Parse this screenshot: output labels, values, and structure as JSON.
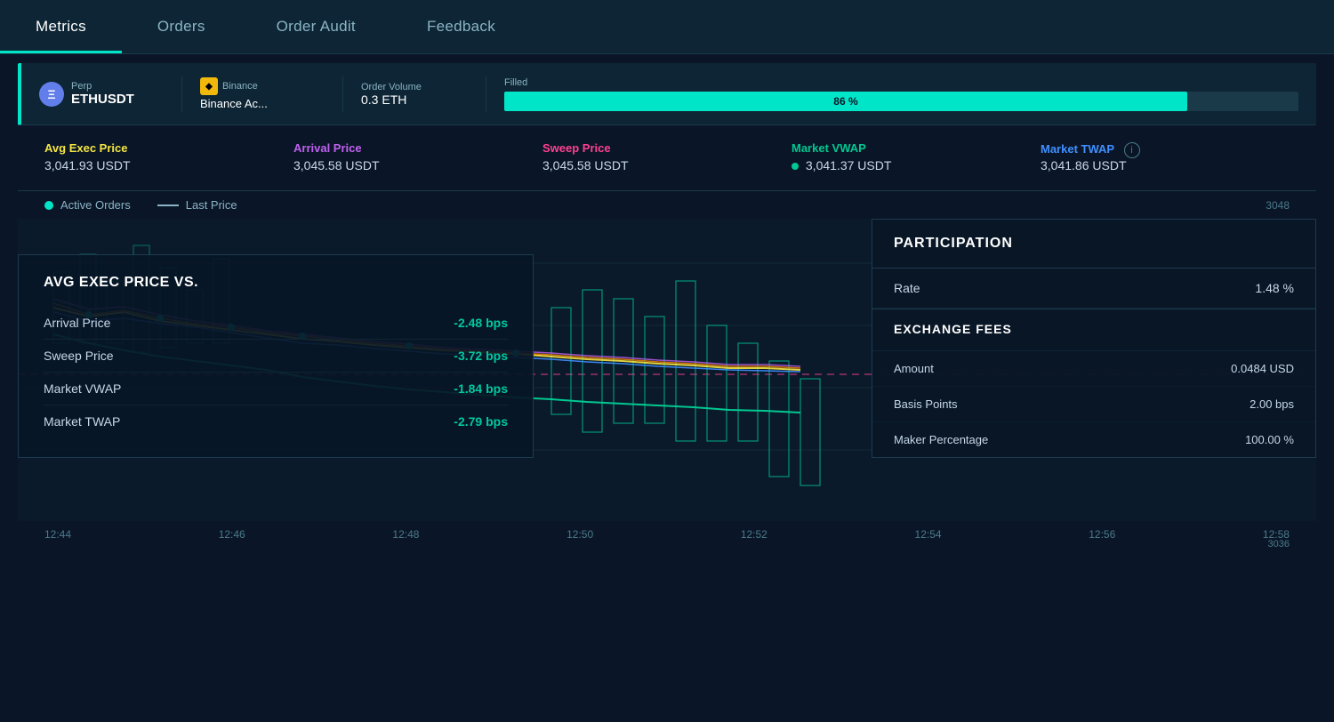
{
  "nav": {
    "tabs": [
      {
        "id": "metrics",
        "label": "Metrics",
        "active": true
      },
      {
        "id": "orders",
        "label": "Orders",
        "active": false
      },
      {
        "id": "order-audit",
        "label": "Order Audit",
        "active": false
      },
      {
        "id": "feedback",
        "label": "Feedback",
        "active": false
      }
    ]
  },
  "order": {
    "type_label": "Perp",
    "symbol": "ETHUSDT",
    "exchange_label": "Binance",
    "exchange_account": "Binance Ac...",
    "volume_label": "Order Volume",
    "volume_value": "0.3 ETH",
    "filled_label": "Filled",
    "fill_percent": 86,
    "fill_percent_text": "86 %"
  },
  "metrics": {
    "avg_exec": {
      "label": "Avg Exec Price",
      "value": "3,041.93 USDT"
    },
    "arrival": {
      "label": "Arrival Price",
      "value": "3,045.58 USDT"
    },
    "sweep": {
      "label": "Sweep Price",
      "value": "3,045.58 USDT"
    },
    "vwap": {
      "label": "Market VWAP",
      "value": "3,041.37 USDT"
    },
    "twap": {
      "label": "Market TWAP",
      "value": "3,041.86 USDT"
    }
  },
  "legend": {
    "active_orders": "Active Orders",
    "last_price": "Last Price"
  },
  "chart": {
    "price_high": "3048",
    "price_low": "3036",
    "x_labels": [
      "12:44",
      "12:46",
      "12:48",
      "12:50",
      "12:52",
      "12:54",
      "12:56",
      "12:58"
    ]
  },
  "avg_exec_panel": {
    "title": "AVG EXEC PRICE VS.",
    "rows": [
      {
        "label": "Arrival Price",
        "value": "-2.48 bps"
      },
      {
        "label": "Sweep Price",
        "value": "-3.72 bps"
      },
      {
        "label": "Market VWAP",
        "value": "-1.84 bps"
      },
      {
        "label": "Market TWAP",
        "value": "-2.79 bps"
      }
    ]
  },
  "participation_panel": {
    "title": "PARTICIPATION",
    "rate_label": "Rate",
    "rate_value": "1.48 %",
    "fees": {
      "title": "EXCHANGE FEES",
      "rows": [
        {
          "label": "Amount",
          "value": "0.0484 USD"
        },
        {
          "label": "Basis Points",
          "value": "2.00 bps"
        },
        {
          "label": "Maker Percentage",
          "value": "100.00 %"
        }
      ]
    }
  }
}
